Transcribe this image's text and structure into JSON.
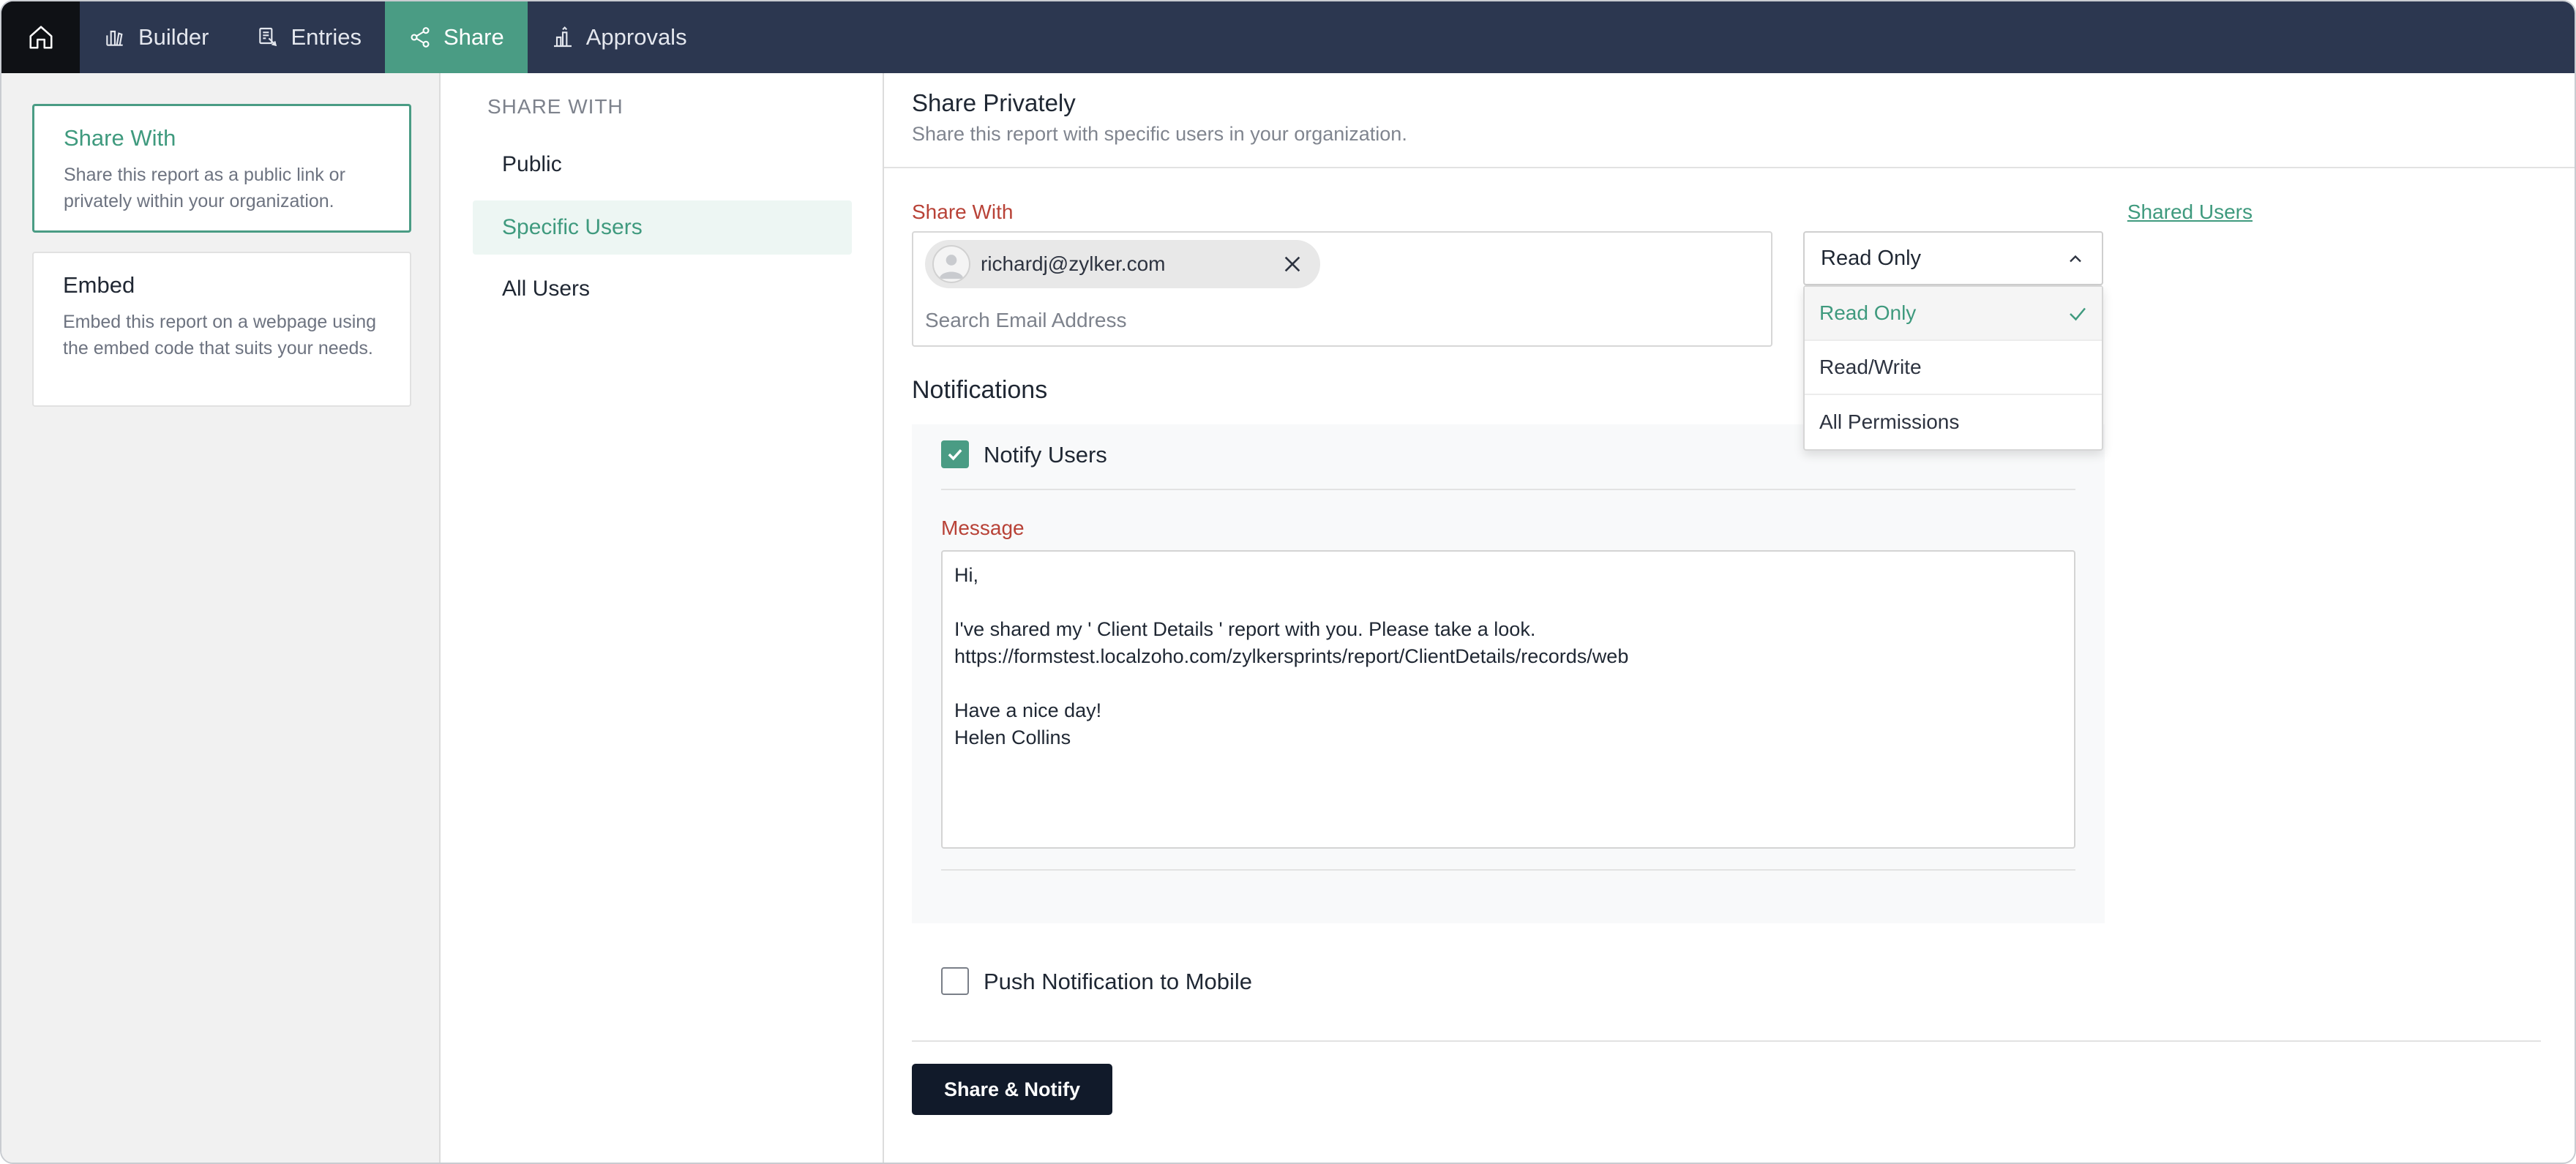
{
  "nav": {
    "tabs": [
      {
        "label": "Builder",
        "icon": "builder-icon"
      },
      {
        "label": "Entries",
        "icon": "entries-icon"
      },
      {
        "label": "Share",
        "icon": "share-icon",
        "active": true
      },
      {
        "label": "Approvals",
        "icon": "approvals-icon"
      }
    ]
  },
  "left": {
    "cards": [
      {
        "title": "Share With",
        "desc": "Share this report as a public link or privately within your organization.",
        "active": true
      },
      {
        "title": "Embed",
        "desc": "Embed this report on a webpage using the embed code that suits your needs."
      }
    ]
  },
  "middle": {
    "heading": "SHARE WITH",
    "items": [
      {
        "label": "Public"
      },
      {
        "label": "Specific Users",
        "active": true
      },
      {
        "label": "All Users"
      }
    ]
  },
  "main": {
    "title": "Share Privately",
    "subtitle": "Share this report with specific users in your organization.",
    "share_with_label": "Share With",
    "shared_users_link": "Shared Users",
    "chip_email": "richardj@zylker.com",
    "search_placeholder": "Search Email Address",
    "permission": {
      "selected": "Read Only",
      "options": [
        "Read Only",
        "Read/Write",
        "All Permissions"
      ]
    },
    "notifications_title": "Notifications",
    "notify_users_label": "Notify Users",
    "notify_users_checked": true,
    "message_label": "Message",
    "message": "Hi,\n\nI've shared my ' Client Details ' report with you. Please take a look.\nhttps://formstest.localzoho.com/zylkersprints/report/ClientDetails/records/web\n\nHave a nice day!\nHelen Collins",
    "push_label": "Push Notification to Mobile",
    "push_checked": false,
    "share_button": "Share & Notify"
  },
  "colors": {
    "nav_bg": "#2c3750",
    "accent": "#4a9c84",
    "label_red": "#b84237",
    "button_dark": "#111a2a"
  }
}
